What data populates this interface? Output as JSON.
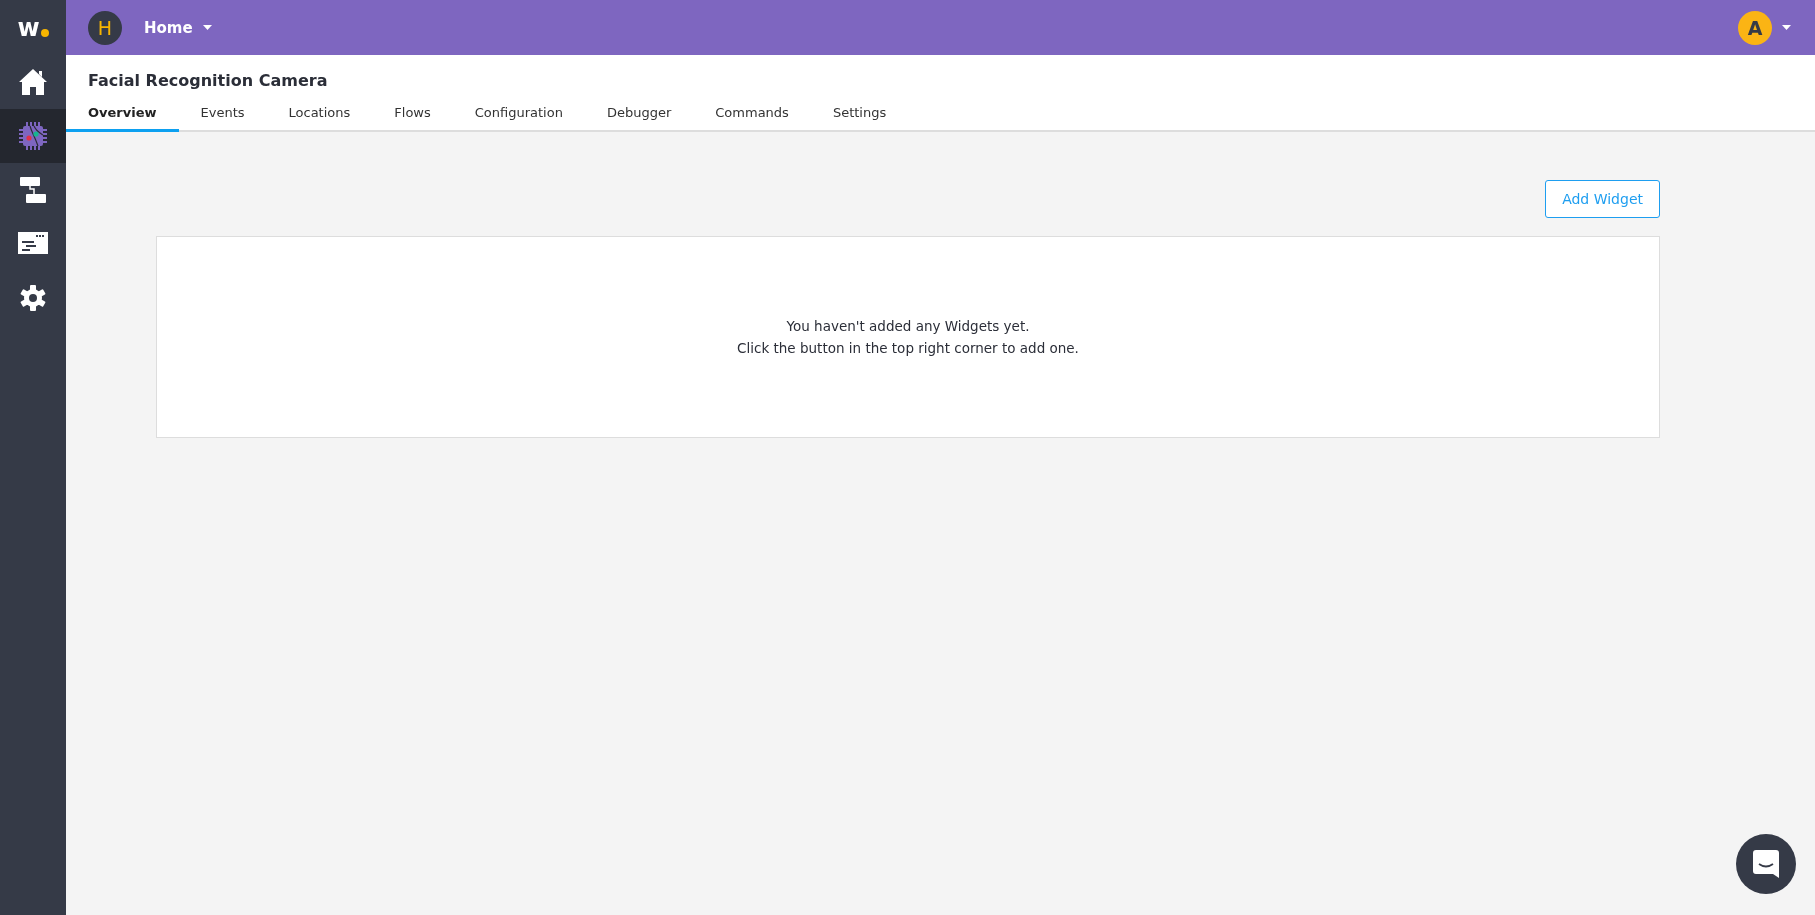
{
  "sidebar": {
    "logo": "w",
    "items": [
      {
        "kind": "home",
        "selected": false
      },
      {
        "kind": "chip",
        "selected": true
      },
      {
        "kind": "flow",
        "selected": false
      },
      {
        "kind": "terminal",
        "selected": false
      },
      {
        "kind": "gear",
        "selected": false
      }
    ]
  },
  "top_bar": {
    "app_avatar": "H",
    "app_name": "Home",
    "user_avatar": "A"
  },
  "page": {
    "title": "Facial Recognition Camera"
  },
  "tabs": [
    {
      "label": "Overview",
      "selected": true
    },
    {
      "label": "Events",
      "selected": false
    },
    {
      "label": "Locations",
      "selected": false
    },
    {
      "label": "Flows",
      "selected": false
    },
    {
      "label": "Configuration",
      "selected": false
    },
    {
      "label": "Debugger",
      "selected": false
    },
    {
      "label": "Commands",
      "selected": false
    },
    {
      "label": "Settings",
      "selected": false
    }
  ],
  "add_button": "Add Widget",
  "empty_state": {
    "lines": [
      "You haven't added any Widgets yet.",
      "Click the button in the top right corner to add one."
    ]
  }
}
